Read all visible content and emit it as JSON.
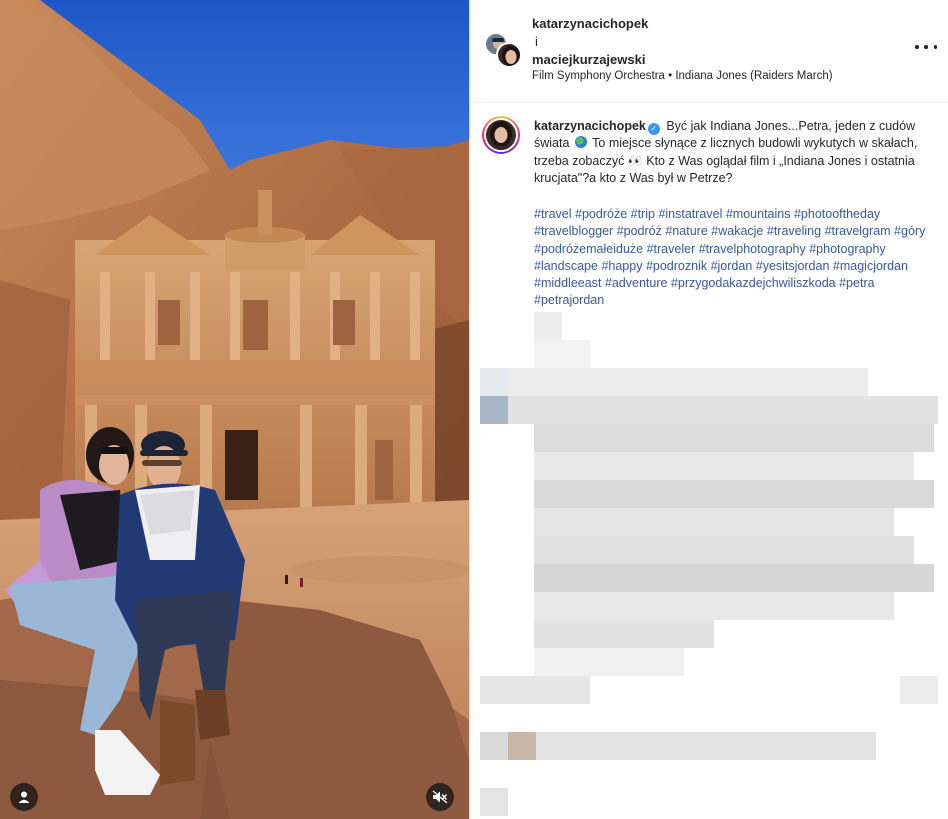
{
  "post": {
    "authors": [
      "katarzynacichopek",
      "maciejkurzajewski"
    ],
    "and_word": "i",
    "music": "Film Symphony Orchestra • Indiana Jones (Raiders March)"
  },
  "caption": {
    "username": "katarzynacichopek",
    "text_part1": "Być jak Indiana Jones...Petra, jeden z cudów świata",
    "text_part2": "To miejsce słynące z licznych budowli wykutych w skałach, trzeba zobaczyć",
    "eyes_emoji": "👀",
    "text_part3": "Kto z Was oglądał film i „Indiana Jones i ostatnia krucjata\"?a kto z Was był w Petrze?"
  },
  "hashtags": [
    "#travel",
    "#podróże",
    "#trip",
    "#instatravel",
    "#mountains",
    "#photooftheday",
    "#travelblogger",
    "#podróż",
    "#nature",
    "#wakacje",
    "#traveling",
    "#travelgram",
    "#góry",
    "#podróżemałeiduże",
    "#traveler",
    "#travelphotography",
    "#photography",
    "#landscape",
    "#happy",
    "#podroznik",
    "#jordan",
    "#yesitsjordan",
    "#magicjordan",
    "#middleeast",
    "#adventure",
    "#przygodakazdejchwiliszkoda",
    "#petra",
    "#petrajordan"
  ],
  "icons": {
    "more": "more-options-icon",
    "verified": "verified-badge-icon",
    "globe": "globe-emoji-icon",
    "user_tag": "user-tag-icon",
    "mute": "audio-muted-icon"
  },
  "colors": {
    "hashtag": "#385898",
    "verified": "#3897f0",
    "sky": "#2a66d9",
    "rock": "#b9784a"
  }
}
